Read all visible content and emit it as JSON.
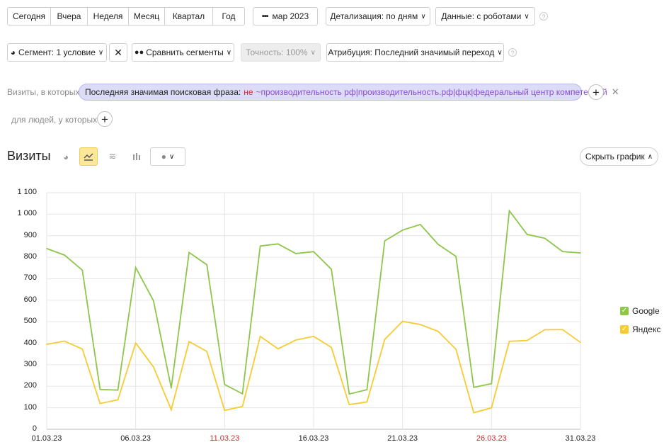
{
  "periods": [
    "Сегодня",
    "Вчера",
    "Неделя",
    "Месяц",
    "Квартал",
    "Год"
  ],
  "date_range": "мар 2023",
  "detail": "Детализация: по дням",
  "data_mode": "Данные: с роботами",
  "segment": "Сегмент: 1 условие",
  "compare": "Сравнить сегменты",
  "accuracy": "Точность: 100%",
  "attribution": "Атрибуция: Последний значимый переход",
  "filter": {
    "visits_label": "Визиты, в которых",
    "chip_field": "Последняя значимая поисковая фраза:",
    "chip_neg": "не",
    "chip_value": "~производительность рф|производительность.рф|фцк|федеральный центр компетенций",
    "people_label": "для людей, у которых"
  },
  "chart_header": {
    "title": "Визиты",
    "hide_button": "Скрыть график"
  },
  "colors": {
    "google": "#8dc64b",
    "yandex": "#f7cb32",
    "red_date": "#e0232e"
  },
  "chart_data": {
    "type": "line",
    "x": [
      "01.03.23",
      "02.03.23",
      "03.03.23",
      "04.03.23",
      "05.03.23",
      "06.03.23",
      "07.03.23",
      "08.03.23",
      "09.03.23",
      "10.03.23",
      "11.03.23",
      "12.03.23",
      "13.03.23",
      "14.03.23",
      "15.03.23",
      "16.03.23",
      "17.03.23",
      "18.03.23",
      "19.03.23",
      "20.03.23",
      "21.03.23",
      "22.03.23",
      "23.03.23",
      "24.03.23",
      "25.03.23",
      "26.03.23",
      "27.03.23",
      "28.03.23",
      "29.03.23",
      "30.03.23",
      "31.03.23"
    ],
    "x_tick_labels": [
      "01.03.23",
      "06.03.23",
      "11.03.23",
      "16.03.23",
      "21.03.23",
      "26.03.23",
      "31.03.23"
    ],
    "red_ticks": [
      "11.03.23",
      "26.03.23"
    ],
    "y_ticks": [
      "0",
      "100",
      "200",
      "300",
      "400",
      "500",
      "600",
      "700",
      "800",
      "900",
      "1 000",
      "1 100"
    ],
    "ylim": [
      0,
      1100
    ],
    "series": [
      {
        "name": "Google",
        "values": [
          840,
          810,
          740,
          185,
          182,
          752,
          598,
          192,
          822,
          765,
          208,
          165,
          852,
          862,
          817,
          826,
          744,
          164,
          184,
          876,
          926,
          952,
          860,
          804,
          195,
          212,
          1016,
          906,
          888,
          826,
          820
        ]
      },
      {
        "name": "Яндекс",
        "values": [
          395,
          410,
          373,
          120,
          137,
          401,
          290,
          91,
          408,
          362,
          88,
          106,
          432,
          374,
          415,
          432,
          381,
          115,
          127,
          418,
          502,
          487,
          455,
          372,
          77,
          100,
          409,
          413,
          463,
          463,
          404
        ]
      }
    ],
    "grid": true,
    "legend": "right"
  }
}
